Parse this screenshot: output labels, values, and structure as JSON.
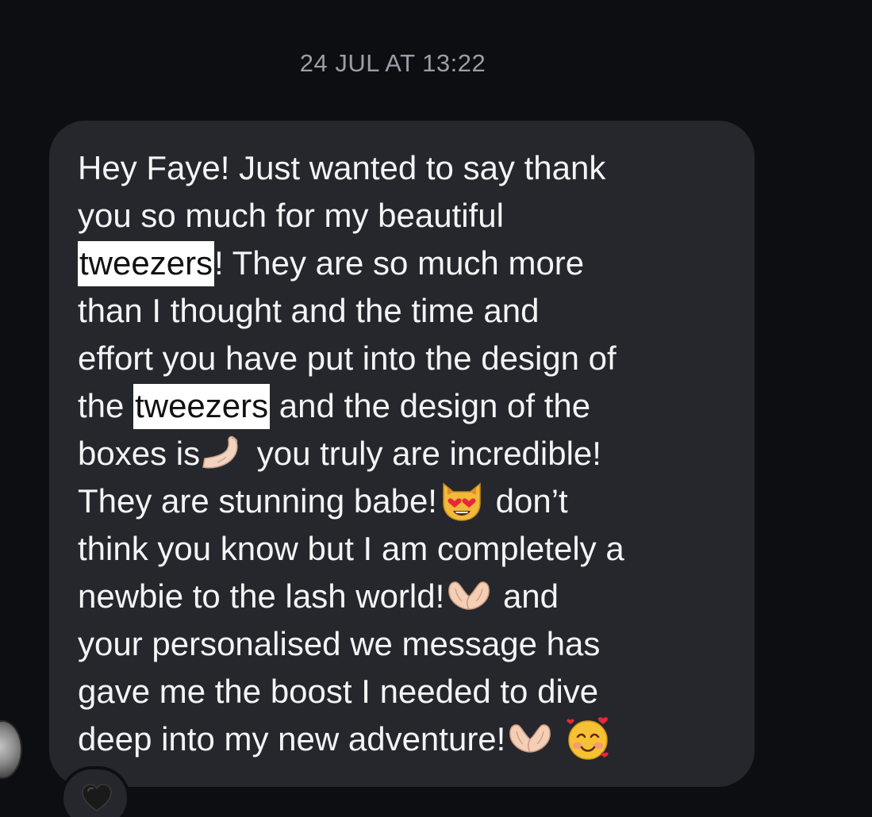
{
  "timestamp": "24 JUL AT 13:22",
  "message": {
    "parts": [
      "Hey Faye! Just wanted to say thank\nyou so much for my beautiful\n",
      "tweezers",
      "! They are so much more\nthan I thought and the time and\neffort you have put into the design of\nthe ",
      "tweezers",
      " and the design of the\nboxes is",
      " you truly are incredible!\nThey are stunning babe!",
      " don’t\nthink you know but I am completely a\nnewbie to the lash world!",
      " and\nyour personalised we message has\ngave me the boost I needed to dive\ndeep into my new adventure!"
    ],
    "highlighted_word": "tweezers",
    "emojis": [
      "pinched-fingers-emoji",
      "heart-eyes-cat-emoji",
      "heart-hands-emoji",
      "heart-hands-emoji",
      "smiling-face-with-hearts-emoji"
    ]
  },
  "reaction": {
    "icon": "black-heart-icon"
  },
  "colors": {
    "background": "#0c0e12",
    "bubble": "#25272c",
    "text": "#f4f4f6",
    "timestamp": "#9a9ea6",
    "highlight": "#ffffff"
  }
}
